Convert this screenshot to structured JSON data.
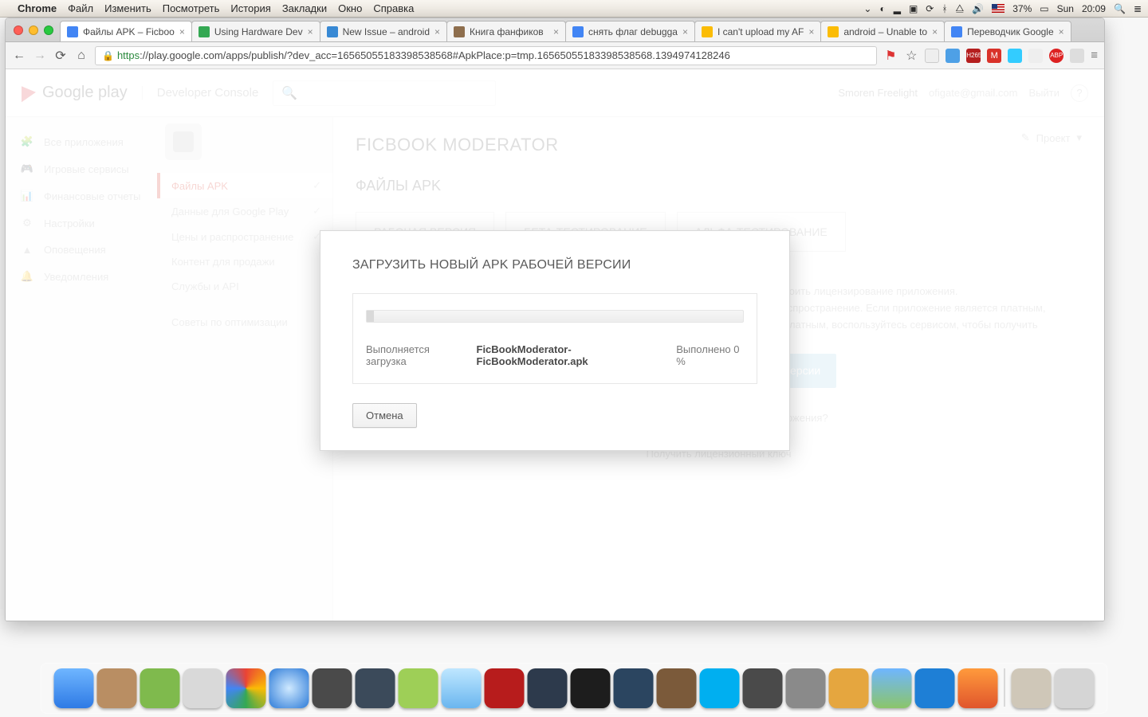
{
  "menubar": {
    "app": "Chrome",
    "items": [
      "Файл",
      "Изменить",
      "Посмотреть",
      "История",
      "Закладки",
      "Окно",
      "Справка"
    ],
    "battery": "37%",
    "day": "Sun",
    "time": "20:09"
  },
  "tabs": [
    {
      "title": "Файлы APK – Ficboo",
      "active": true
    },
    {
      "title": "Using Hardware Dev"
    },
    {
      "title": "New Issue – android"
    },
    {
      "title": "Книга фанфиков"
    },
    {
      "title": "снять флаг debugga"
    },
    {
      "title": "I can't upload my AF"
    },
    {
      "title": "android – Unable to"
    },
    {
      "title": "Переводчик Google"
    }
  ],
  "url": {
    "scheme": "https",
    "rest": "://play.google.com/apps/publish/?dev_acc=16565055183398538568#ApkPlace:p=tmp.16565055183398538568.1394974128246"
  },
  "ext_h265": "H265",
  "ext_m": "M",
  "ext_abp": "ABP",
  "header": {
    "logo": "Google play",
    "console": "Developer Console",
    "user_name": "Smoren Freelight",
    "user_email": "ofigate@gmail.com",
    "signout": "Выйти"
  },
  "leftnav": [
    {
      "label": "Все приложения",
      "icon": "🧩"
    },
    {
      "label": "Игровые сервисы",
      "icon": "🎮"
    },
    {
      "label": "Финансовые отчеты",
      "icon": "📊"
    },
    {
      "label": "Настройки",
      "icon": "⚙"
    },
    {
      "label": "Оповещения",
      "icon": "▲"
    },
    {
      "label": "Уведомления",
      "icon": "🔔",
      "alert": true
    }
  ],
  "subnav": {
    "items": [
      {
        "label": "Файлы APK",
        "active": true
      },
      {
        "label": "Данные для Google Play"
      },
      {
        "label": "Цены и распространение"
      },
      {
        "label": "Контент для продажи"
      },
      {
        "label": "Службы и API"
      }
    ],
    "tip": "Советы по оптимизации"
  },
  "main": {
    "app_title": "FICBOOK MODERATOR",
    "project_btn": "Проект",
    "section": "ФАЙЛЫ APK",
    "tabs": [
      "РАБОЧАЯ ВЕРСИЯ",
      "БЕТА-ТЕСТИРОВАНИЕ",
      "АЛЬФА-ТЕСТИРОВАНИЕ"
    ],
    "helper": [
      "Страница лицензирования и продажи контента позволяет настроить лицензирование приложения.",
      "Лицензирование приложения позволяет предотвращать несанкционированное распространение. Если приложение является платным,",
      "советуем установить правила лицензирования. Если приложение является бесплатным, воспользуйтесь сервисом, чтобы получить"
    ],
    "primary_btn": "Загрузить первый APK рабочей версии",
    "license_q": "Нужен лицензионный ключ для приложения?",
    "get_license": "Получить лицензионный ключ"
  },
  "modal": {
    "title": "ЗАГРУЗИТЬ НОВЫЙ APK РАБОЧЕЙ ВЕРСИИ",
    "status_prefix": "Выполняется загрузка",
    "filename": "FicBookModerator-FicBookModerator.apk",
    "done_label": "Выполнено 0 %",
    "cancel": "Отмена"
  }
}
